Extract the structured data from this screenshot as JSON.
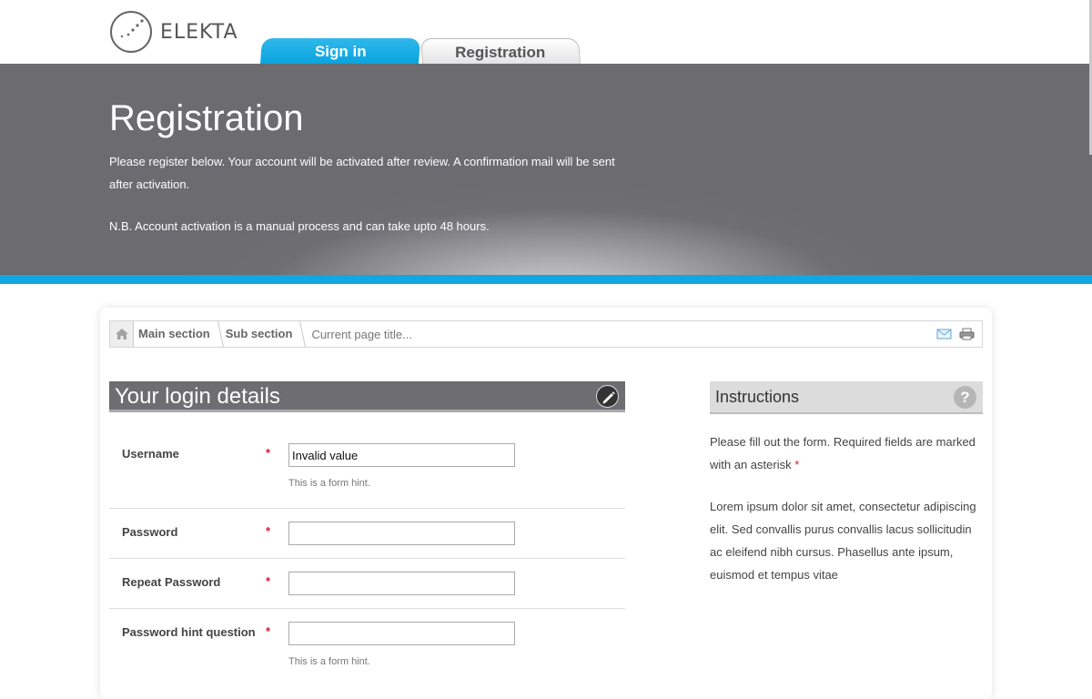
{
  "header": {
    "logo_text": "ELEKTA",
    "tabs": [
      {
        "label": "Sign in",
        "active": true
      },
      {
        "label": "Registration",
        "active": false
      }
    ]
  },
  "hero": {
    "title": "Registration",
    "text": "Please register below. Your account will be activated after review. A confirmation mail will be sent after activation.",
    "note": "N.B. Account activation is a manual process and can take upto 48 hours."
  },
  "breadcrumb": {
    "items": [
      "Main section",
      "Sub section"
    ],
    "current": "Current page title..."
  },
  "form": {
    "title": "Your login details",
    "fields": [
      {
        "label": "Username",
        "required": "*",
        "value": "Invalid value",
        "hint": "This is a form hint."
      },
      {
        "label": "Password",
        "required": "*",
        "value": "",
        "hint": ""
      },
      {
        "label": "Repeat Password",
        "required": "*",
        "value": "",
        "hint": ""
      },
      {
        "label": "Password hint question",
        "required": "*",
        "value": "",
        "hint": "This is a form hint."
      }
    ]
  },
  "instructions": {
    "title": "Instructions",
    "help_symbol": "?",
    "required_text": "Please fill out the form. Required fields are marked with an asterisk",
    "required_star": "*",
    "body": "Lorem ipsum dolor sit amet, consectetur adipiscing elit. Sed convallis purus convallis lacus sollicitudin ac eleifend nibh cursus. Phasellus ante ipsum, euismod et tempus vitae"
  },
  "colors": {
    "accent": "#12a6e2",
    "hero": "#6d6d72",
    "required": "#d21d2f"
  }
}
